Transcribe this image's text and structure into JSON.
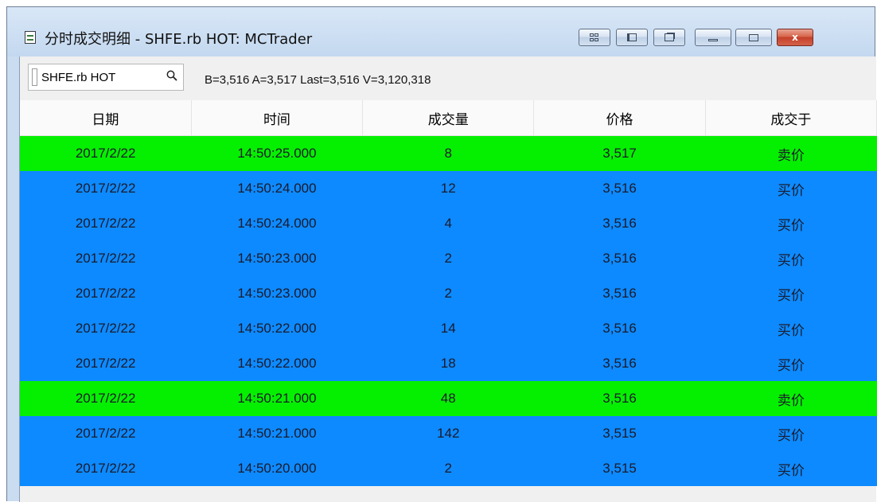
{
  "window": {
    "title": "分时成交明细 - SHFE.rb HOT: MCTrader",
    "buttons": [
      "layout",
      "pin",
      "detach",
      "minimize",
      "maximize",
      "close"
    ],
    "close_label": "x"
  },
  "toolbar": {
    "symbol_value": "SHFE.rb HOT",
    "quote": "B=3,516 A=3,517 Last=3,516 V=3,120,318"
  },
  "table": {
    "columns": [
      "日期",
      "时间",
      "成交量",
      "价格",
      "成交于"
    ],
    "rows": [
      {
        "date": "2017/2/22",
        "time": "14:50:25.000",
        "volume": "8",
        "price": "3,517",
        "side": "卖价",
        "kind": "sell"
      },
      {
        "date": "2017/2/22",
        "time": "14:50:24.000",
        "volume": "12",
        "price": "3,516",
        "side": "买价",
        "kind": "buy"
      },
      {
        "date": "2017/2/22",
        "time": "14:50:24.000",
        "volume": "4",
        "price": "3,516",
        "side": "买价",
        "kind": "buy"
      },
      {
        "date": "2017/2/22",
        "time": "14:50:23.000",
        "volume": "2",
        "price": "3,516",
        "side": "买价",
        "kind": "buy"
      },
      {
        "date": "2017/2/22",
        "time": "14:50:23.000",
        "volume": "2",
        "price": "3,516",
        "side": "买价",
        "kind": "buy"
      },
      {
        "date": "2017/2/22",
        "time": "14:50:22.000",
        "volume": "14",
        "price": "3,516",
        "side": "买价",
        "kind": "buy"
      },
      {
        "date": "2017/2/22",
        "time": "14:50:22.000",
        "volume": "18",
        "price": "3,516",
        "side": "买价",
        "kind": "buy"
      },
      {
        "date": "2017/2/22",
        "time": "14:50:21.000",
        "volume": "48",
        "price": "3,516",
        "side": "卖价",
        "kind": "sell"
      },
      {
        "date": "2017/2/22",
        "time": "14:50:21.000",
        "volume": "142",
        "price": "3,515",
        "side": "买价",
        "kind": "buy"
      },
      {
        "date": "2017/2/22",
        "time": "14:50:20.000",
        "volume": "2",
        "price": "3,515",
        "side": "买价",
        "kind": "buy"
      }
    ]
  },
  "colors": {
    "buy_row": "#0d8aff",
    "sell_row": "#05f000"
  }
}
